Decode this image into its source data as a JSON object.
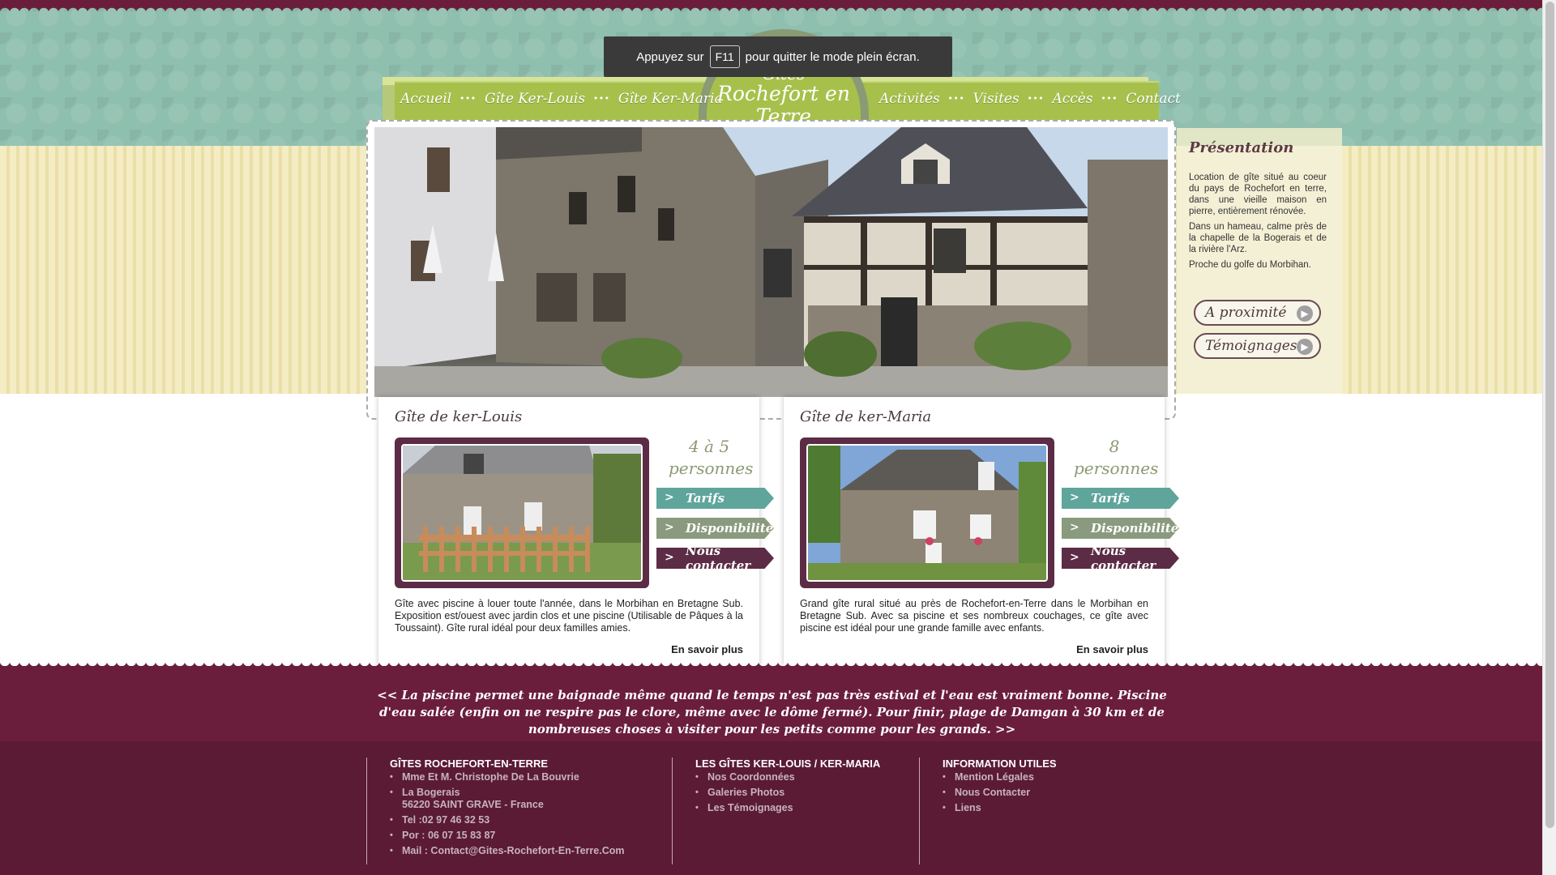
{
  "toast": {
    "before": "Appuyez sur",
    "key": "F11",
    "after": "pour quitter le mode plein écran."
  },
  "logo": {
    "line1": "Gîtes",
    "line2": "Rochefort en Terre"
  },
  "nav": {
    "left": [
      "Accueil",
      "Gîte Ker-Louis",
      "Gîte Ker-Maria"
    ],
    "right": [
      "Activités",
      "Visites",
      "Accès",
      "Contact"
    ],
    "separator": "···"
  },
  "sidebar": {
    "title": "Présentation",
    "paragraphs": [
      "Location de gîte situé au coeur du pays de Rochefort en terre, dans une vieille maison en pierre, entièrement rénovée.",
      "Dans un hameau, calme près de la chapelle de la Bogerais et de la rivière l'Arz.",
      "Proche du golfe du Morbihan."
    ],
    "buttons": [
      "A proximité",
      "Témoignages"
    ]
  },
  "cards": [
    {
      "title": "Gîte de ker-Louis",
      "capacity_line1": "4 à 5",
      "capacity_line2": "personnes",
      "btn_tarifs": "Tarifs",
      "btn_dispo": "Disponibilités",
      "btn_contact": "Nous contacter",
      "description": "Gîte avec piscine à louer toute l'année, dans le Morbihan en Bretagne Sub. Exposition est/ouest avec jardin clos et une piscine (Utilisable de Pâques à la Toussaint). Gîte rural idéal pour deux familles amies.",
      "more": "En savoir plus"
    },
    {
      "title": "Gîte de ker-Maria",
      "capacity_line1": "8",
      "capacity_line2": "personnes",
      "btn_tarifs": "Tarifs",
      "btn_dispo": "Disponibilités",
      "btn_contact": "Nous contacter",
      "description": "Grand gîte rural situé au près de Rochefort-en-Terre dans le Morbihan en Bretagne Sub. Avec sa piscine et ses nombreux couchages, ce gîte avec piscine est idéal pour une grande famille avec enfants.",
      "more": "En savoir plus"
    }
  ],
  "testimonial": "<< La piscine permet une baignade même quand le temps n'est pas très estival et l'eau est vraiment bonne. Piscine d'eau salée (enfin on ne respire pas le clore, même avec le dôme fermé). Pour finir, plage de Damgan à 30 km et de nombreuses choses à visiter pour les petits comme pour les grands. >>",
  "footer": {
    "col1": {
      "title": "GÎTES ROCHEFORT-EN-TERRE",
      "owner": "Mme Et M. Christophe De La Bouvrie",
      "address1": "La Bogerais",
      "address2": "56220 SAINT GRAVE - France",
      "tel": "Tel :02 97 46 32 53",
      "por": "Por : 06 07 15 83 87",
      "mail": "Mail : Contact@Gites-Rochefort-En-Terre.Com"
    },
    "col2": {
      "title": "LES GÎTES KER-LOUIS / KER-MARIA",
      "links": [
        "Nos Coordonnées",
        "Galeries Photos",
        "Les Témoignages"
      ]
    },
    "col3": {
      "title": "INFORMATION UTILES",
      "links": [
        "Mention Légales",
        "Nous Contacter",
        "Liens"
      ]
    }
  },
  "colors": {
    "teal_pattern": "#8fbfae",
    "nav_green": "#a7c04b",
    "burgundy": "#6b1e3c",
    "footer": "#5b1b34",
    "btn_tarifs": "#5fa59c",
    "btn_dispo": "#8a9a7e",
    "btn_contact": "#5c2b45"
  }
}
